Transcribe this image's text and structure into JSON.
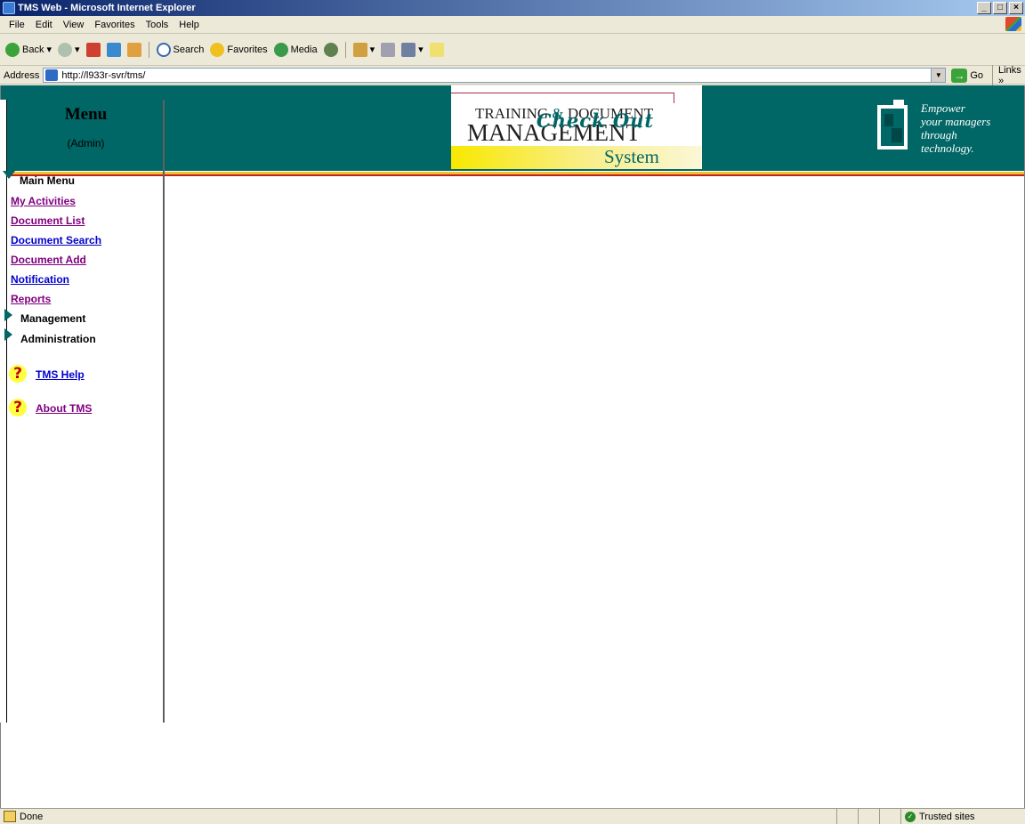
{
  "window": {
    "title": "TMS Web - Microsoft Internet Explorer"
  },
  "menubar": [
    "File",
    "Edit",
    "View",
    "Favorites",
    "Tools",
    "Help"
  ],
  "toolbar": {
    "back": "Back",
    "search": "Search",
    "favorites": "Favorites",
    "media": "Media"
  },
  "address": {
    "label": "Address",
    "url": "http://l933r-svr/tms/",
    "go": "Go",
    "links": "Links"
  },
  "header": {
    "logo_line1_a": "TRAINING",
    "logo_line1_amp": "&",
    "logo_line1_b": "DOCUMENT",
    "logo_line2": "MANAGEMENT",
    "logo_line3": "System",
    "tagline": [
      "Empower",
      "your managers",
      "through",
      "technology."
    ]
  },
  "sidebar": {
    "title": "Menu",
    "role": "(Admin)",
    "main_menu": "Main Menu",
    "items": [
      {
        "label": "My Activities",
        "visited": true
      },
      {
        "label": "Document List",
        "visited": true
      },
      {
        "label": "Document Search",
        "visited": false
      },
      {
        "label": "Document Add",
        "visited": true
      },
      {
        "label": "Notification",
        "visited": false
      },
      {
        "label": "Reports",
        "visited": true
      }
    ],
    "management": "Management",
    "administration": "Administration",
    "help": "TMS Help",
    "about": "About TMS"
  },
  "main": {
    "title": "Check Out"
  },
  "status": {
    "text": "Done",
    "zone": "Trusted sites"
  }
}
